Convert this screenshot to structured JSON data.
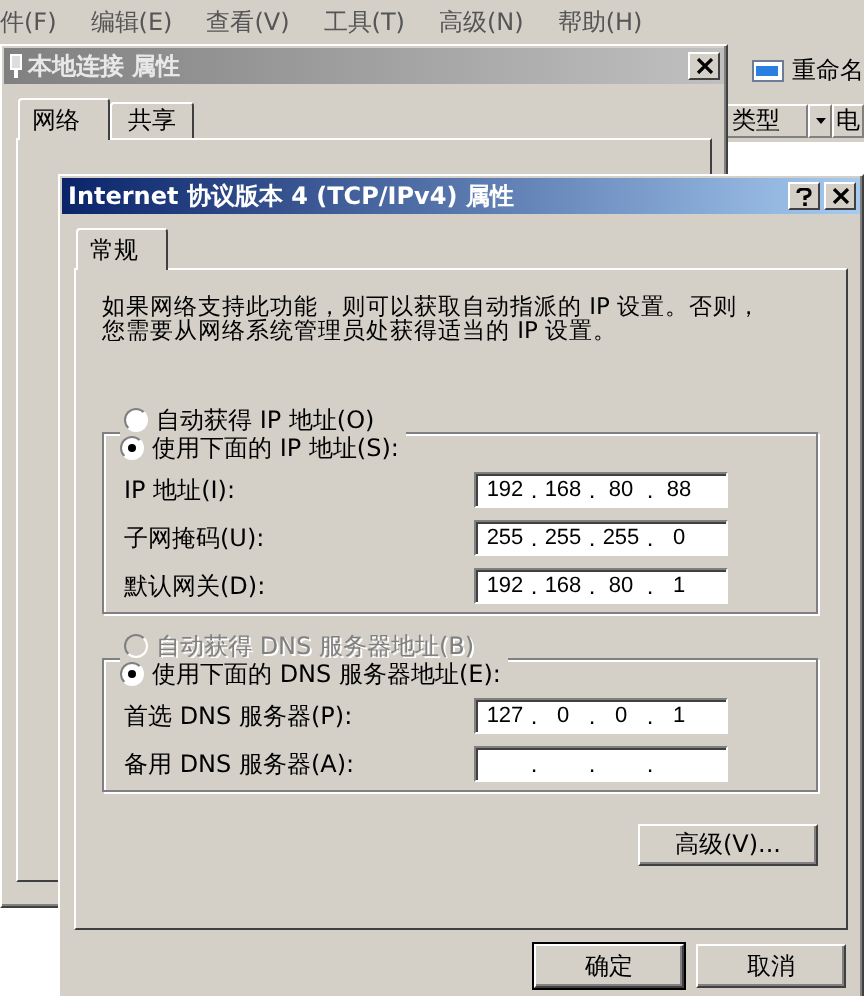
{
  "explorer": {
    "menu": [
      "件(F)",
      "编辑(E)",
      "查看(V)",
      "工具(T)",
      "高级(N)",
      "帮助(H)"
    ],
    "toolbar": {
      "rename": "重命名"
    },
    "columns": [
      {
        "label": "类型",
        "dropdown": true
      },
      {
        "label": "电",
        "dropdown": false
      }
    ]
  },
  "back_dialog": {
    "title": "本地连接 属性",
    "active": false,
    "tabs": [
      {
        "label": "网络",
        "selected": true
      },
      {
        "label": "共享",
        "selected": false
      }
    ]
  },
  "dialog": {
    "title": "Internet 协议版本 4 (TCP/IPv4) 属性",
    "active": true,
    "tabs": [
      {
        "label": "常规",
        "selected": true
      }
    ],
    "description": [
      "如果网络支持此功能，则可以获取自动指派的 IP 设置。否则，",
      "您需要从网络系统管理员处获得适当的 IP 设置。"
    ],
    "sections": [
      {
        "auto_radio": {
          "label": "自动获得 IP 地址(O)",
          "selected": false,
          "disabled": false
        },
        "manual_radio": {
          "label": "使用下面的 IP 地址(S):",
          "selected": true,
          "disabled": false
        },
        "fields": [
          {
            "label": "IP 地址(I):",
            "separator": ".",
            "octets": [
              "192",
              "168",
              "80",
              "88"
            ]
          },
          {
            "label": "子网掩码(U):",
            "separator": ".",
            "octets": [
              "255",
              "255",
              "255",
              "0"
            ]
          },
          {
            "label": "默认网关(D):",
            "separator": ".",
            "octets": [
              "192",
              "168",
              "80",
              "1"
            ]
          }
        ]
      },
      {
        "auto_radio": {
          "label": "自动获得 DNS 服务器地址(B)",
          "selected": false,
          "disabled": true
        },
        "manual_radio": {
          "label": "使用下面的 DNS 服务器地址(E):",
          "selected": true,
          "disabled": false
        },
        "fields": [
          {
            "label": "首选 DNS 服务器(P):",
            "separator": ".",
            "octets": [
              "127",
              "0",
              "0",
              "1"
            ]
          },
          {
            "label": "备用 DNS 服务器(A):",
            "separator": "."
          }
        ]
      }
    ],
    "advanced_button": "高级(V)...",
    "buttons": [
      {
        "label": "确定",
        "default": true
      },
      {
        "label": "取消",
        "default": false
      }
    ]
  }
}
